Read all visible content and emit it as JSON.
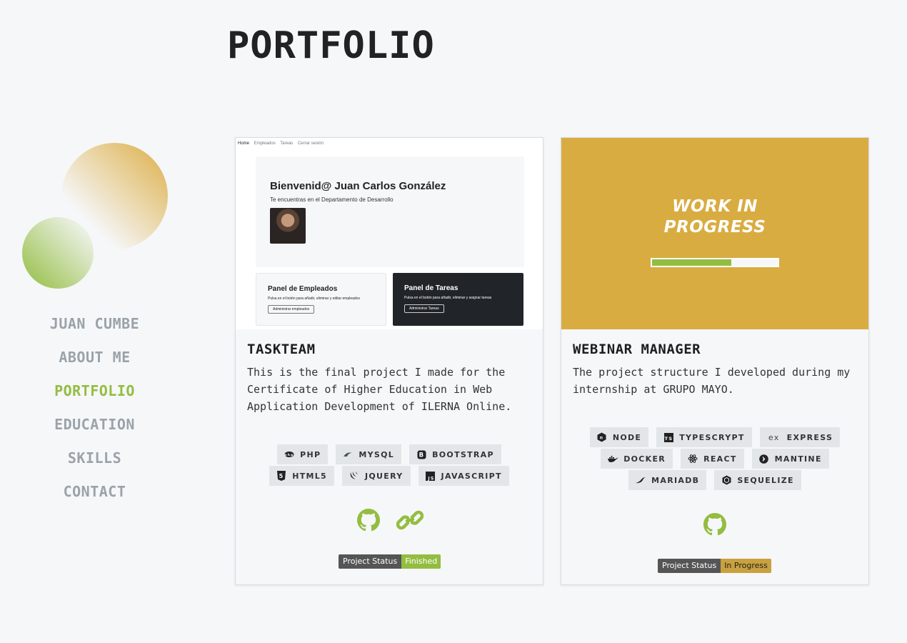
{
  "page": {
    "title": "PORTFOLIO"
  },
  "sidebar": {
    "items": [
      {
        "label": "JUAN CUMBE",
        "active": false
      },
      {
        "label": "ABOUT ME",
        "active": false
      },
      {
        "label": "PORTFOLIO",
        "active": true
      },
      {
        "label": "EDUCATION",
        "active": false
      },
      {
        "label": "SKILLS",
        "active": false
      },
      {
        "label": "CONTACT",
        "active": false
      }
    ]
  },
  "colors": {
    "accent_green": "#93bd41",
    "accent_gold": "#d9ac41",
    "nav_inactive": "#9aa3a9",
    "background": "#f6f7f9"
  },
  "projects": [
    {
      "title": "TASKTEAM",
      "description": "This is the final project I made for the Certificate of Higher Education in Web Application Development of ILERNA Online.",
      "thumbnail": {
        "nav": [
          "Home",
          "Empleados",
          "Tareas",
          "Cerrar sesión"
        ],
        "heading": "Bienvenid@ Juan Carlos González",
        "subheading": "Te encuentras en el Departamento de Desarrollo",
        "panel_left": {
          "title": "Panel de Empleados",
          "text": "Pulsa en el botón para añadir, eliminar y editar empleados",
          "button": "Administrar empleados"
        },
        "panel_right": {
          "title": "Panel de Tareas",
          "text": "Pulsa en el botón para añadir, eliminar y asignar tareas",
          "button": "Administrar Tareas"
        }
      },
      "tags": [
        {
          "label": "PHP",
          "icon": "php-icon"
        },
        {
          "label": "MYSQL",
          "icon": "mysql-icon"
        },
        {
          "label": "BOOTSTRAP",
          "icon": "bootstrap-icon"
        },
        {
          "label": "HTML5",
          "icon": "html5-icon"
        },
        {
          "label": "JQUERY",
          "icon": "jquery-icon"
        },
        {
          "label": "JAVASCRIPT",
          "icon": "javascript-icon"
        }
      ],
      "links": [
        "github-icon",
        "link-icon"
      ],
      "status": {
        "label": "Project Status",
        "value": "Finished",
        "color": "#93bd41"
      }
    },
    {
      "title": "WEBINAR MANAGER",
      "description": "The project structure I developed during my internship at GRUPO MAYO.",
      "thumbnail": {
        "line1": "WORK IN",
        "line2": "PROGRESS",
        "progress": 0.63
      },
      "tags": [
        {
          "label": "NODE",
          "icon": "node-icon"
        },
        {
          "label": "TYPESCRYPT",
          "icon": "typescript-icon"
        },
        {
          "label": "EXPRESS",
          "icon": "express-icon"
        },
        {
          "label": "DOCKER",
          "icon": "docker-icon"
        },
        {
          "label": "REACT",
          "icon": "react-icon"
        },
        {
          "label": "MANTINE",
          "icon": "mantine-icon"
        },
        {
          "label": "MARIADB",
          "icon": "mariadb-icon"
        },
        {
          "label": "SEQUELIZE",
          "icon": "sequelize-icon"
        }
      ],
      "links": [
        "github-icon"
      ],
      "status": {
        "label": "Project Status",
        "value": "In Progress",
        "color": "#c9a13f"
      }
    }
  ]
}
